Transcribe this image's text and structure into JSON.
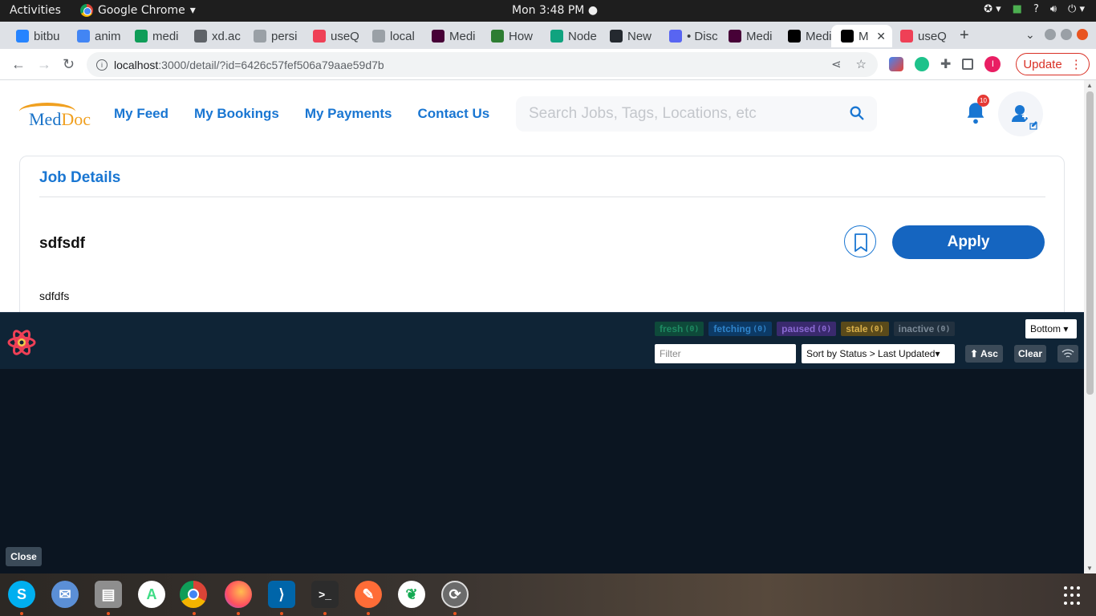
{
  "system_bar": {
    "activities": "Activities",
    "app_name": "Google Chrome",
    "clock": "Mon  3:48 PM"
  },
  "tabs": [
    {
      "label": "bitbu",
      "fav_color": "#2684ff"
    },
    {
      "label": "anim",
      "fav_color": "#4285f4"
    },
    {
      "label": "medi",
      "fav_color": "#0f9d58"
    },
    {
      "label": "xd.ac",
      "fav_color": "#5f6368"
    },
    {
      "label": "persi",
      "fav_color": "#9aa0a6"
    },
    {
      "label": "useQ",
      "fav_color": "#ef4056"
    },
    {
      "label": "local",
      "fav_color": "#9aa0a6"
    },
    {
      "label": "Medi",
      "fav_color": "#470137"
    },
    {
      "label": "How",
      "fav_color": "#2e7d32"
    },
    {
      "label": "Node",
      "fav_color": "#10a37f"
    },
    {
      "label": "New",
      "fav_color": "#24292f"
    },
    {
      "label": "• Disc",
      "fav_color": "#5865f2"
    },
    {
      "label": "Medi",
      "fav_color": "#470137"
    },
    {
      "label": "Medi",
      "fav_color": "#000000"
    },
    {
      "label": "M",
      "fav_color": "#000000",
      "active": true
    },
    {
      "label": "useQ",
      "fav_color": "#ef4056"
    }
  ],
  "address_bar": {
    "host": "localhost",
    "path": ":3000/detail/?id=6426c57fef506a79aae59d7b"
  },
  "update_label": "Update",
  "profile_initial": "I",
  "site": {
    "logo_med": "Med",
    "logo_doc": "Doc",
    "nav": [
      "My Feed",
      "My Bookings",
      "My Payments",
      "Contact Us"
    ],
    "search_placeholder": "Search Jobs, Tags, Locations, etc",
    "notification_count": "10"
  },
  "job": {
    "section_title": "Job Details",
    "title": "sdfsdf",
    "apply_label": "Apply",
    "description": "sdfdfs"
  },
  "devtools": {
    "chips": [
      {
        "label": "fresh",
        "count": "(0)"
      },
      {
        "label": "fetching",
        "count": "(0)"
      },
      {
        "label": "paused",
        "count": "(0)"
      },
      {
        "label": "stale",
        "count": "(0)"
      },
      {
        "label": "inactive",
        "count": "(0)"
      }
    ],
    "position_select": "Bottom",
    "filter_placeholder": "Filter",
    "sort_select": "Sort by Status > Last Updated",
    "asc_label": "⬆ Asc",
    "clear_label": "Clear",
    "close_label": "Close"
  },
  "colors": {
    "brand_blue": "#1976d2",
    "apply_blue": "#1565c0",
    "devtools_bg": "#0b1521",
    "ubuntu_orange": "#e95420"
  }
}
